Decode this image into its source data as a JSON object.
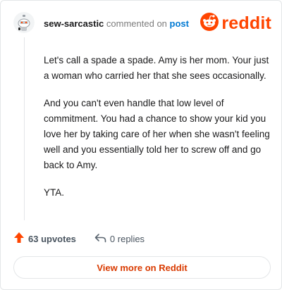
{
  "header": {
    "username": "sew-sarcastic",
    "commented_text": "commented on",
    "post_link": "post",
    "logo_text": "reddit",
    "avatar_icon": "snoo-avatar-icon",
    "logo_icon": "reddit-snoo-logo-icon"
  },
  "comment": {
    "paragraphs": [
      "Let's call a spade a spade. Amy is her mom. Your just a woman who carried her that she sees occasionally.",
      "And you can't even handle that low level of commitment. You had a chance to show your kid you love her by taking care of her when she wasn't feeling well and you essentially told her to screw off and go back to Amy.",
      "YTA."
    ]
  },
  "actions": {
    "upvotes": "63 upvotes",
    "replies": "0 replies",
    "upvote_icon": "upvote-arrow-icon",
    "reply_icon": "reply-arrow-icon"
  },
  "footer": {
    "view_more": "View more on Reddit"
  },
  "colors": {
    "brand": "#ff4500",
    "link": "#0079d3",
    "view_more_text": "#d93a00",
    "border": "#e4e6e8"
  }
}
